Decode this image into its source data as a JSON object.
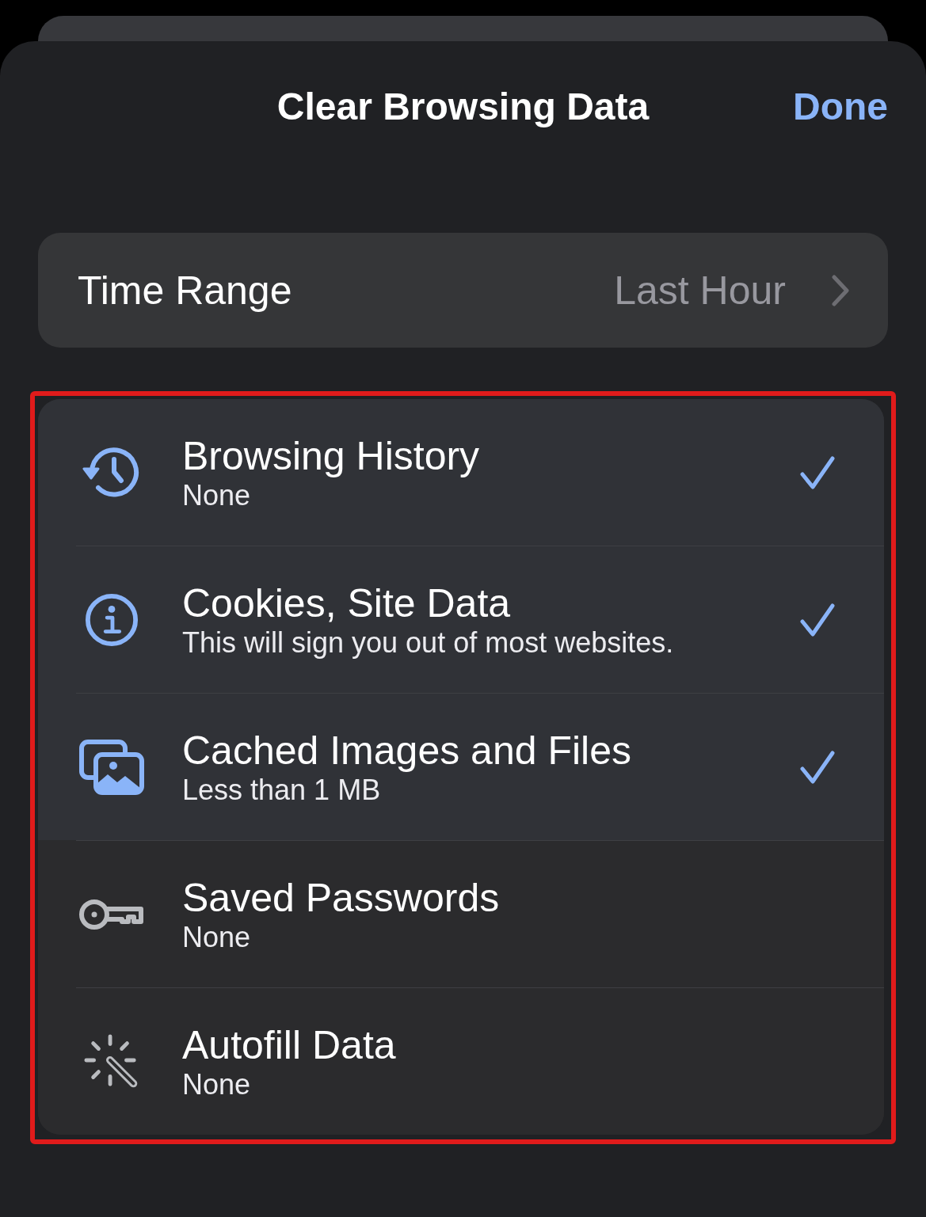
{
  "sheet": {
    "title": "Clear Browsing Data",
    "done_button": "Done"
  },
  "time_range": {
    "label": "Time Range",
    "value": "Last Hour"
  },
  "items": [
    {
      "kind": "history",
      "title": "Browsing History",
      "detail": "None",
      "selected": true
    },
    {
      "kind": "cookies",
      "title": "Cookies, Site Data",
      "detail": "This will sign you out of most websites.",
      "selected": true
    },
    {
      "kind": "cache",
      "title": "Cached Images and Files",
      "detail": "Less than 1 MB",
      "selected": true
    },
    {
      "kind": "passwords",
      "title": "Saved Passwords",
      "detail": "None",
      "selected": false
    },
    {
      "kind": "autofill",
      "title": "Autofill Data",
      "detail": "None",
      "selected": false
    }
  ]
}
